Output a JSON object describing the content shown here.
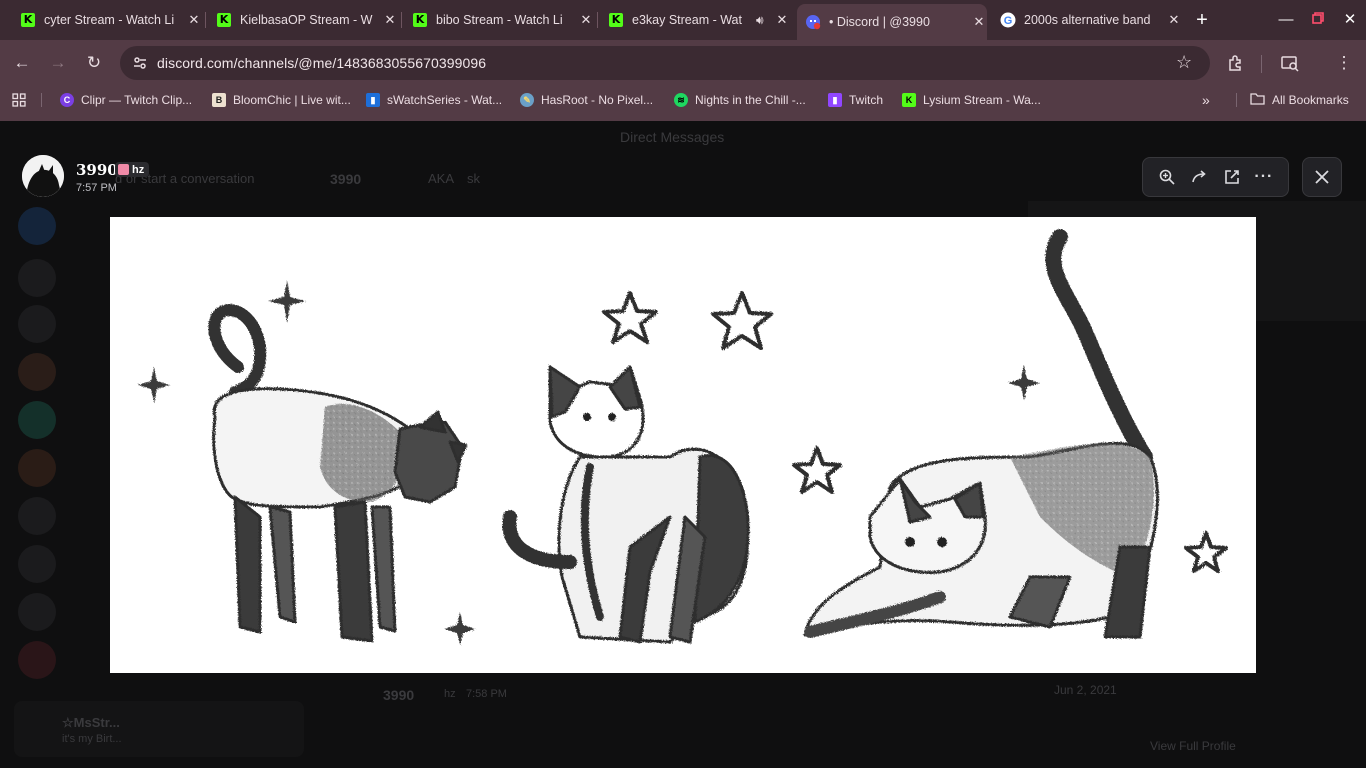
{
  "browser": {
    "tabs": [
      {
        "title": "cyter Stream - Watch Li",
        "icon": "kick-icon"
      },
      {
        "title": "KielbasaOP Stream - W",
        "icon": "kick-icon"
      },
      {
        "title": "bibo Stream - Watch Li",
        "icon": "kick-icon"
      },
      {
        "title": "e3kay Stream - Wat",
        "icon": "kick-icon",
        "audio": true
      },
      {
        "title": "• Discord | @3990",
        "icon": "discord-icon",
        "active": true
      },
      {
        "title": "2000s alternative band",
        "icon": "google-icon"
      }
    ],
    "url": "discord.com/channels/@me/1483683055670399096",
    "bookmarks": [
      {
        "label": "Clipr — Twitch Clip...",
        "icon": "clipr-icon"
      },
      {
        "label": "BloomChic | Live wit...",
        "icon": "bloomchic-icon"
      },
      {
        "label": "sWatchSeries - Wat...",
        "icon": "swatchseries-icon"
      },
      {
        "label": "HasRoot - No Pixel...",
        "icon": "hasroot-icon"
      },
      {
        "label": "Nights in the Chill -...",
        "icon": "spotify-icon"
      },
      {
        "label": "Twitch",
        "icon": "twitch-icon"
      },
      {
        "label": "Lysium Stream - Wa...",
        "icon": "kick-icon"
      }
    ],
    "all_bookmarks_label": "All Bookmarks"
  },
  "viewer": {
    "username": "3990",
    "tag": "hz",
    "time": "7:57 PM",
    "image_description_icon": "cats-doodle-image"
  },
  "background": {
    "dm_header": "Direct Messages",
    "find_conversation": "d or start a conversation",
    "channel_name": "3990",
    "aka": "AKA",
    "aka_value": "sk",
    "message_user": "3990",
    "message_tag": "hz",
    "message_time": "7:58 PM",
    "side_date": "Jun 2, 2021",
    "view_profile": "View Full Profile",
    "user_panel_name": "☆MsStr...",
    "user_panel_status": "it's my Birt..."
  },
  "colors": {
    "tabbar": "#3b2a32",
    "toolbar": "#533b45",
    "kick_green": "#53fc18",
    "overlay": "#0f0f10"
  }
}
